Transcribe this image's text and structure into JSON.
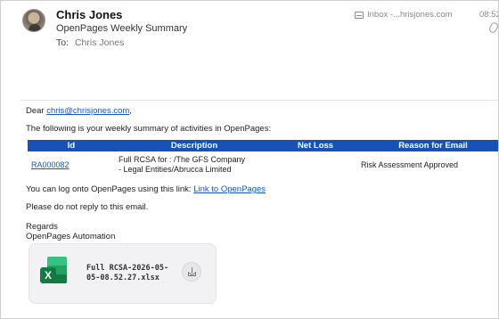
{
  "email": {
    "sender_name": "Chris Jones",
    "subject": "OpenPages Weekly Summary",
    "to_label": "To:",
    "to_name": "Chris Jones",
    "mailbox": "Inbox -...hrisjones.com",
    "time": "08:52"
  },
  "body": {
    "greeting_prefix": "Dear ",
    "greeting_email": "chris@chrisjones.com",
    "greeting_suffix": ",",
    "intro": "The following is your weekly summary of activities in OpenPages:",
    "table": {
      "headers": [
        "Id",
        "Description",
        "Net Loss",
        "Reason for Email"
      ],
      "rows": [
        {
          "id": "RA000082",
          "description_line1": "Full RCSA for : /The GFS Company",
          "description_line2": "- Legal Entities/Abrucca Limited",
          "net_loss": "",
          "reason": "Risk Assessment Approved"
        }
      ]
    },
    "logon_text": "You can log onto OpenPages using this link: ",
    "logon_link": "Link to OpenPages",
    "noreply": "Please do not reply to this email.",
    "regards": "Regards",
    "signature": "OpenPages Automation"
  },
  "attachment": {
    "file_name_line1": "Full RCSA-2026-05-",
    "file_name_line2": "05-08.52.27.xlsx",
    "icon": "excel-icon",
    "badge_letter": "X"
  },
  "colors": {
    "table_header": "#1652b8",
    "link": "#1a55c4",
    "excel_green": "#107c41"
  }
}
